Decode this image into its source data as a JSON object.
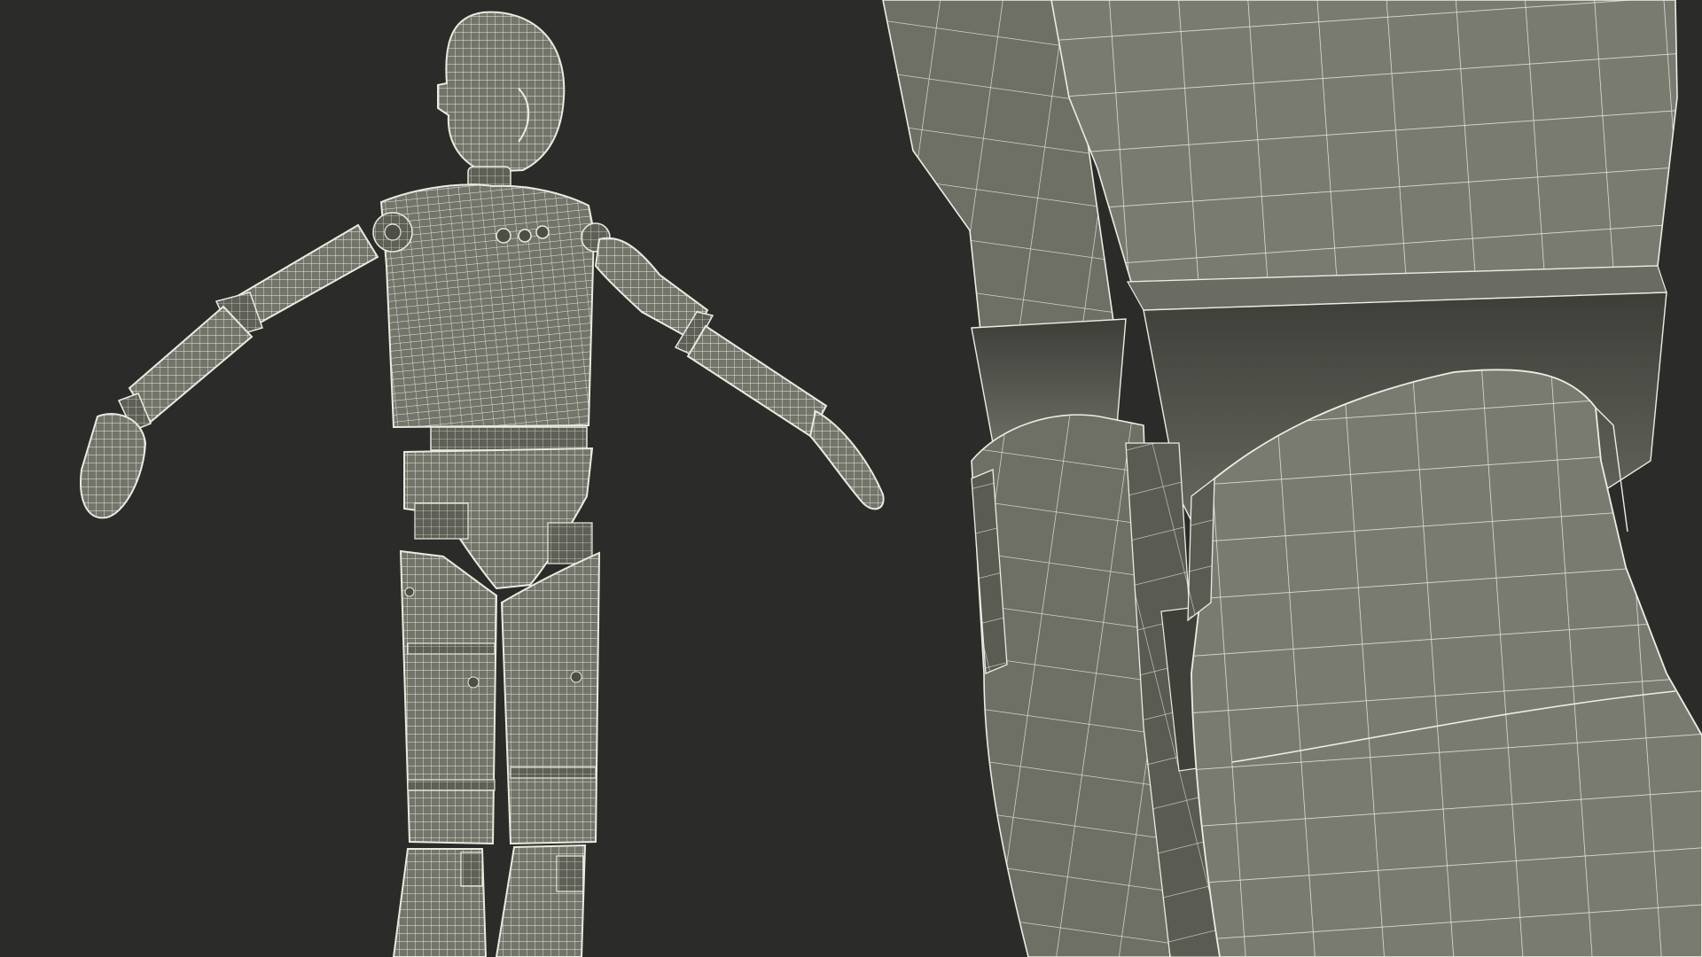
{
  "scene": {
    "background_color": "#2b2b2a",
    "mesh_fill_color": "#74756a",
    "mesh_shadow_color": "#4d4e46",
    "wire_color": "#e9ebe0",
    "views": [
      {
        "name": "full-body-view",
        "subject": "wireframe-crash-test-dummy-child"
      },
      {
        "name": "knee-closeup-view",
        "subject": "wireframe-knee-joint-closeup"
      }
    ]
  }
}
